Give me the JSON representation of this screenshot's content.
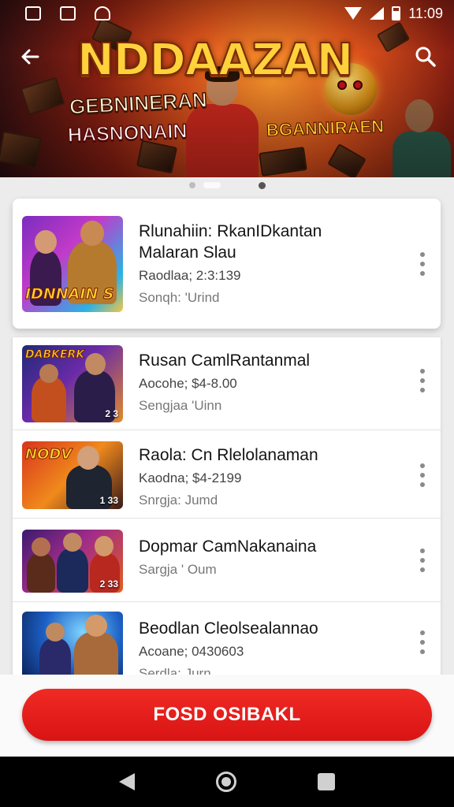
{
  "status_bar": {
    "time": "11:09"
  },
  "hero": {
    "title": "NDDAAZAN",
    "subtitle_1": "GEBNINERAN",
    "subtitle_2": "HASNONAIN",
    "subtitle_3": "BGANNIRAEN"
  },
  "featured": {
    "title_line1": "Rlunahiin: RkanIDkantan",
    "title_line2": "Malaran Slau",
    "meta": "Raodlaa; 2:3:139",
    "meta2": "Sonqh: 'Urind",
    "thumb_label": "IDNNAIN S"
  },
  "items": [
    {
      "title": "Rusan CamlRantanmal",
      "meta": "Aocohe; $4-8.00",
      "meta2": "Sengjaa 'Uinn",
      "thumb_label": "DABKERK",
      "thumb_num": "2 3"
    },
    {
      "title": "Raola: Cn Rlelolanaman",
      "meta": "Kaodna; $4-2199",
      "meta2": "Snrgja: Jumd",
      "thumb_label": "NODV",
      "thumb_num": "1 33"
    },
    {
      "title": "Dopmar CamNakanaina",
      "meta": "",
      "meta2": "Sargja ' Oum",
      "thumb_label": "",
      "thumb_num": "2 33"
    },
    {
      "title": "Beodlan Cleolsealannao",
      "meta": "Acoane; 0430603",
      "meta2": "Serdla: Jurn",
      "thumb_label": "",
      "thumb_num": ""
    }
  ],
  "cta": {
    "label": "FOSD OSIBAKL"
  },
  "colors": {
    "accent": "#e01b1b",
    "hero_orange": "#e0541c"
  }
}
